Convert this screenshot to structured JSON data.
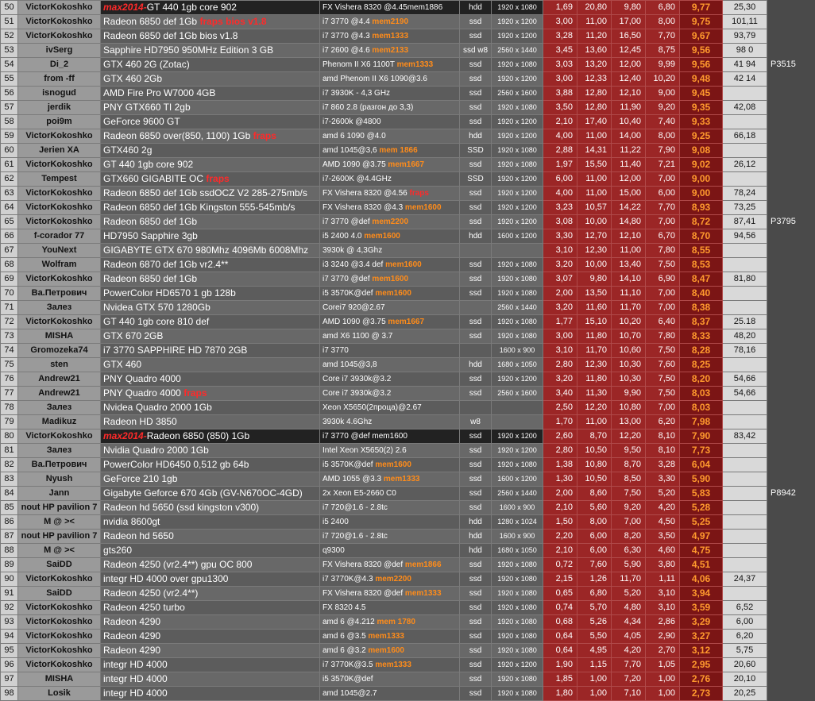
{
  "rows": [
    {
      "n": "50",
      "user": "VictorKokoshko",
      "gpu_prefix": "max2014-",
      "gpu": "GT 440  1gb core 902",
      "gpu_suffix": "",
      "cpu": "FX Vishera  8320 @4.45mem1886",
      "cpu_mem": "",
      "drive": "hdd",
      "res": "1920 x 1080",
      "v1": "1,69",
      "v2": "20,80",
      "v3": "9,80",
      "v4": "6,80",
      "score": "9,77",
      "extra": "25,30",
      "pc": "",
      "hl": true
    },
    {
      "n": "51",
      "user": "VictorKokoshko",
      "gpu_prefix": "",
      "gpu": "Radeon 6850 def  1Gb",
      "gpu_suffix": "fraps      bios v1.8",
      "cpu": "i7 3770 @4.4 ",
      "cpu_mem": "mem2190",
      "drive": "ssd",
      "res": "1920 x 1200",
      "v1": "3,00",
      "v2": "11,00",
      "v3": "17,00",
      "v4": "8,00",
      "score": "9,75",
      "extra": "101,11",
      "pc": ""
    },
    {
      "n": "52",
      "user": "VictorKokoshko",
      "gpu_prefix": "",
      "gpu": "Radeon 6850 def  1Gb                       bios v1.8",
      "gpu_suffix": "",
      "cpu": "i7 3770 @4.3 ",
      "cpu_mem": "mem1333",
      "drive": "ssd",
      "res": "1920 x 1200",
      "v1": "3,28",
      "v2": "11,20",
      "v3": "16,50",
      "v4": "7,70",
      "score": "9,67",
      "extra": "93,79",
      "pc": ""
    },
    {
      "n": "53",
      "user": "ivSerg",
      "gpu_prefix": "",
      "gpu": "Sapphire HD7950 950MHz Edition 3 GB",
      "gpu_suffix": "",
      "cpu": "i7 2600 @4.6 ",
      "cpu_mem": "mem2133",
      "drive": "ssd w8",
      "res": "2560 x 1440",
      "v1": "3,45",
      "v2": "13,60",
      "v3": "12,45",
      "v4": "8,75",
      "score": "9,56",
      "extra": "98  0",
      "pc": ""
    },
    {
      "n": "54",
      "user": "Di_2",
      "gpu_prefix": "",
      "gpu": "GTX 460 2G (Zotac)",
      "gpu_suffix": "",
      "cpu": "Phenom II X6 1100T ",
      "cpu_mem": "mem1333",
      "drive": "ssd",
      "res": "1920 x 1080",
      "v1": "3,03",
      "v2": "13,20",
      "v3": "12,00",
      "v4": "9,99",
      "score": "9,56",
      "extra": "41  94",
      "pc": "P3515"
    },
    {
      "n": "55",
      "user": "from -ff",
      "gpu_prefix": "",
      "gpu": "GTX 460 2Gb",
      "gpu_suffix": "",
      "cpu": "amd Phenom II X6 1090@3.6",
      "cpu_mem": "",
      "drive": "ssd",
      "res": "1920 x 1200",
      "v1": "3,00",
      "v2": "12,33",
      "v3": "12,40",
      "v4": "10,20",
      "score": "9,48",
      "extra": "42  14",
      "pc": ""
    },
    {
      "n": "56",
      "user": "isnogud",
      "gpu_prefix": "",
      "gpu": "AMD Fire Pro W7000 4GB",
      "gpu_suffix": "",
      "cpu": "i7 3930K - 4,3 GHz",
      "cpu_mem": "",
      "drive": "ssd",
      "res": "2560 x 1600",
      "v1": "3,88",
      "v2": "12,80",
      "v3": "12,10",
      "v4": "9,00",
      "score": "9,45",
      "extra": "",
      "pc": ""
    },
    {
      "n": "57",
      "user": "jerdik",
      "gpu_prefix": "",
      "gpu": "PNY GTX660 TI 2gb",
      "gpu_suffix": "",
      "cpu": "i7 860 2.8 (разгон до 3,3)",
      "cpu_mem": "",
      "drive": "ssd",
      "res": "1920 x 1080",
      "v1": "3,50",
      "v2": "12,80",
      "v3": "11,90",
      "v4": "9,20",
      "score": "9,35",
      "extra": "42,08",
      "pc": ""
    },
    {
      "n": "58",
      "user": "poi9m",
      "gpu_prefix": "",
      "gpu": "GeForce 9600 GT",
      "gpu_suffix": "",
      "cpu": "i7-2600k @4800",
      "cpu_mem": "",
      "drive": "ssd",
      "res": "1920 x 1200",
      "v1": "2,10",
      "v2": "17,40",
      "v3": "10,40",
      "v4": "7,40",
      "score": "9,33",
      "extra": "",
      "pc": ""
    },
    {
      "n": "59",
      "user": "VictorKokoshko",
      "gpu_prefix": "",
      "gpu": "Radeon 6850 over(850, 1100) 1Gb",
      "gpu_suffix": "fraps",
      "cpu": "amd 6  1090 @4.0",
      "cpu_mem": "",
      "drive": "hdd",
      "res": "1920 x 1200",
      "v1": "4,00",
      "v2": "11,00",
      "v3": "14,00",
      "v4": "8,00",
      "score": "9,25",
      "extra": "66,18",
      "pc": ""
    },
    {
      "n": "60",
      "user": "Jerien XA",
      "gpu_prefix": "",
      "gpu": "GTX460 2g",
      "gpu_suffix": "",
      "cpu": "amd 1045@3,6 ",
      "cpu_mem": "mem 1866",
      "drive": "SSD",
      "res": "1920 x 1080",
      "v1": "2,88",
      "v2": "14,31",
      "v3": "11,22",
      "v4": "7,90",
      "score": "9,08",
      "extra": "",
      "pc": ""
    },
    {
      "n": "61",
      "user": "VictorKokoshko",
      "gpu_prefix": "",
      "gpu": "GT 440  1gb core 902",
      "gpu_suffix": "",
      "cpu": "AMD 1090 @3.75 ",
      "cpu_mem": "mem1667",
      "drive": "ssd",
      "res": "1920 x 1080",
      "v1": "1,97",
      "v2": "15,50",
      "v3": "11,40",
      "v4": "7,21",
      "score": "9,02",
      "extra": "26,12",
      "pc": ""
    },
    {
      "n": "62",
      "user": "Tempest",
      "gpu_prefix": "",
      "gpu": "GTX660 GIGABITE OC",
      "gpu_suffix": "fraps",
      "cpu": "i7-2600K @4.4GHz",
      "cpu_mem": "",
      "drive": "SSD",
      "res": "1920 x 1200",
      "v1": "6,00",
      "v2": "11,00",
      "v3": "12,00",
      "v4": "7,00",
      "score": "9,00",
      "extra": "",
      "pc": ""
    },
    {
      "n": "63",
      "user": "VictorKokoshko",
      "gpu_prefix": "",
      "gpu": "Radeon 6850 def  1Gb  ssdOCZ V2 285-275mb/s",
      "gpu_suffix": "",
      "cpu": "FX Vishera  8320 @4.56 ",
      "cpu_mem": "fraps",
      "drive": "ssd",
      "res": "1920 x 1200",
      "v1": "4,00",
      "v2": "11,00",
      "v3": "15,00",
      "v4": "6,00",
      "score": "9,00",
      "extra": "78,24",
      "pc": ""
    },
    {
      "n": "64",
      "user": "VictorKokoshko",
      "gpu_prefix": "",
      "gpu": "Radeon 6850 def  1Gb   Kingston 555-545mb/s",
      "gpu_suffix": "",
      "cpu": "FX Vishera  8320 @4.3 ",
      "cpu_mem": "mem1600",
      "drive": "ssd",
      "res": "1920 x 1200",
      "v1": "3,23",
      "v2": "10,57",
      "v3": "14,22",
      "v4": "7,70",
      "score": "8,93",
      "extra": "73,25",
      "pc": ""
    },
    {
      "n": "65",
      "user": "VictorKokoshko",
      "gpu_prefix": "",
      "gpu": "Radeon 6850 def  1Gb",
      "gpu_suffix": "",
      "cpu": "i7 3770 @def ",
      "cpu_mem": "mem2200",
      "drive": "ssd",
      "res": "1920 x 1200",
      "v1": "3,08",
      "v2": "10,00",
      "v3": "14,80",
      "v4": "7,00",
      "score": "8,72",
      "extra": "87,41",
      "pc": "P3795"
    },
    {
      "n": "66",
      "user": "f-corador 77",
      "gpu_prefix": "",
      "gpu": "HD7950 Sapphire 3gb",
      "gpu_suffix": "",
      "cpu": "i5 2400 4.0 ",
      "cpu_mem": "mem1600",
      "drive": "hdd",
      "res": "1600 x 1200",
      "v1": "3,30",
      "v2": "12,70",
      "v3": "12,10",
      "v4": "6,70",
      "score": "8,70",
      "extra": "94,56",
      "pc": ""
    },
    {
      "n": "67",
      "user": "YouNext",
      "gpu_prefix": "",
      "gpu": "GIGABYTE GTX 670 980Mhz 4096Mb 6008Mhz",
      "gpu_suffix": "",
      "cpu": "3930k @ 4,3Ghz",
      "cpu_mem": "",
      "drive": "",
      "res": "",
      "v1": "3,10",
      "v2": "12,30",
      "v3": "11,00",
      "v4": "7,80",
      "score": "8,55",
      "extra": "",
      "pc": ""
    },
    {
      "n": "68",
      "user": "Wolfram",
      "gpu_prefix": "",
      "gpu": "Radeon 6870 def  1Gb  vr2.4**",
      "gpu_suffix": "",
      "cpu": "i3 3240 @3.4 def ",
      "cpu_mem": "mem1600",
      "drive": "ssd",
      "res": "1920 x 1080",
      "v1": "3,20",
      "v2": "10,00",
      "v3": "13,40",
      "v4": "7,50",
      "score": "8,53",
      "extra": "",
      "pc": ""
    },
    {
      "n": "69",
      "user": "VictorKokoshko",
      "gpu_prefix": "",
      "gpu": "Radeon 6850 def  1Gb",
      "gpu_suffix": "",
      "cpu": "i7 3770 @def ",
      "cpu_mem": "mem1600",
      "drive": "ssd",
      "res": "1920 x 1080",
      "v1": "3,07",
      "v2": "9,80",
      "v3": "14,10",
      "v4": "6,90",
      "score": "8,47",
      "extra": "81,80",
      "pc": ""
    },
    {
      "n": "70",
      "user": "Ва.Петрович",
      "gpu_prefix": "",
      "gpu": "PowerColor HD6570  1 gb 128b",
      "gpu_suffix": "",
      "cpu": "i5 3570K@def ",
      "cpu_mem": "mem1600",
      "drive": "ssd",
      "res": "1920 x 1080",
      "v1": "2,00",
      "v2": "13,50",
      "v3": "11,10",
      "v4": "7,00",
      "score": "8,40",
      "extra": "",
      "pc": ""
    },
    {
      "n": "71",
      "user": "Залез",
      "gpu_prefix": "",
      "gpu": "Nvidea GTX 570 1280Gb",
      "gpu_suffix": "",
      "cpu": "Corei7 920@2.67",
      "cpu_mem": "",
      "drive": "",
      "res": "2560 x 1440",
      "v1": "3,20",
      "v2": "11,60",
      "v3": "11,70",
      "v4": "7,00",
      "score": "8,38",
      "extra": "",
      "pc": ""
    },
    {
      "n": "72",
      "user": "VictorKokoshko",
      "gpu_prefix": "",
      "gpu": "GT 440  1gb core 810 def",
      "gpu_suffix": "",
      "cpu": "AMD 1090 @3.75 ",
      "cpu_mem": "mem1667",
      "drive": "ssd",
      "res": "1920 x 1080",
      "v1": "1,77",
      "v2": "15,10",
      "v3": "10,20",
      "v4": "6,40",
      "score": "8,37",
      "extra": "25.18",
      "pc": ""
    },
    {
      "n": "73",
      "user": "MISHA",
      "gpu_prefix": "",
      "gpu": "GTX 670 2GB",
      "gpu_suffix": "",
      "cpu": "amd X6 1100 @ 3.7",
      "cpu_mem": "",
      "drive": "ssd",
      "res": "1920 x 1080",
      "v1": "3,00",
      "v2": "11,80",
      "v3": "10,70",
      "v4": "7,80",
      "score": "8,33",
      "extra": "48,20",
      "pc": ""
    },
    {
      "n": "74",
      "user": "Gromozeka74",
      "gpu_prefix": "",
      "gpu": "i7 3770 SAPPHIRE HD 7870 2GB",
      "gpu_suffix": "",
      "cpu": "i7 3770",
      "cpu_mem": "",
      "drive": "",
      "res": "1600 x 900",
      "v1": "3,10",
      "v2": "11,70",
      "v3": "10,60",
      "v4": "7,50",
      "score": "8,28",
      "extra": "78,16",
      "pc": ""
    },
    {
      "n": "75",
      "user": "sten",
      "gpu_prefix": "",
      "gpu": "GTX 460",
      "gpu_suffix": "",
      "cpu": "amd 1045@3,8",
      "cpu_mem": "",
      "drive": "hdd",
      "res": "1680 x 1050",
      "v1": "2,80",
      "v2": "12,30",
      "v3": "10,30",
      "v4": "7,60",
      "score": "8,25",
      "extra": "",
      "pc": ""
    },
    {
      "n": "76",
      "user": "Andrew21",
      "gpu_prefix": "",
      "gpu": "PNY Quadro 4000",
      "gpu_suffix": "",
      "cpu": "Core i7 3930k@3.2",
      "cpu_mem": "",
      "drive": "ssd",
      "res": "1920 x 1200",
      "v1": "3,20",
      "v2": "11,80",
      "v3": "10,30",
      "v4": "7,50",
      "score": "8,20",
      "extra": "54,66",
      "pc": ""
    },
    {
      "n": "77",
      "user": "Andrew21",
      "gpu_prefix": "",
      "gpu": "PNY Quadro 4000",
      "gpu_suffix": "fraps",
      "cpu": "Core i7 3930k@3.2",
      "cpu_mem": "",
      "drive": "ssd",
      "res": "2560 x 1600",
      "v1": "3,40",
      "v2": "11,30",
      "v3": "9,90",
      "v4": "7,50",
      "score": "8,03",
      "extra": "54,66",
      "pc": ""
    },
    {
      "n": "78",
      "user": "Залез",
      "gpu_prefix": "",
      "gpu": "Nvidea Quadro 2000 1Gb",
      "gpu_suffix": "",
      "cpu": "Xeon X5650(2проца)@2.67",
      "cpu_mem": "",
      "drive": "",
      "res": "",
      "v1": "2,50",
      "v2": "12,20",
      "v3": "10,80",
      "v4": "7,00",
      "score": "8,03",
      "extra": "",
      "pc": ""
    },
    {
      "n": "79",
      "user": "Madikuz",
      "gpu_prefix": "",
      "gpu": "Radeon HD 3850",
      "gpu_suffix": "",
      "cpu": "3930k 4.6Ghz",
      "cpu_mem": "",
      "drive": "w8",
      "res": "",
      "v1": "1,70",
      "v2": "11,00",
      "v3": "13,00",
      "v4": "6,20",
      "score": "7,98",
      "extra": "",
      "pc": ""
    },
    {
      "n": "80",
      "user": "VictorKokoshko",
      "gpu_prefix": "max2014-",
      "gpu": "Radeon 6850 (850)  1Gb",
      "gpu_suffix": "",
      "cpu": "i7 3770 @def mem1600",
      "cpu_mem": "",
      "drive": "ssd",
      "res": "1920 x 1200",
      "v1": "2,60",
      "v2": "8,70",
      "v3": "12,20",
      "v4": "8,10",
      "score": "7,90",
      "extra": "83,42",
      "pc": "",
      "hl": true
    },
    {
      "n": "81",
      "user": "Залез",
      "gpu_prefix": "",
      "gpu": "Nvidia Quadro 2000 1Gb",
      "gpu_suffix": "",
      "cpu": "Intel Xeon X5650(2) 2.6",
      "cpu_mem": "",
      "drive": "ssd",
      "res": "1920 x 1200",
      "v1": "2,80",
      "v2": "10,50",
      "v3": "9,50",
      "v4": "8,10",
      "score": "7,73",
      "extra": "",
      "pc": ""
    },
    {
      "n": "82",
      "user": "Ва.Петрович",
      "gpu_prefix": "",
      "gpu": "PowerColor HD6450 0,512 gb 64b",
      "gpu_suffix": "",
      "cpu": "i5 3570K@def ",
      "cpu_mem": "mem1600",
      "drive": "ssd",
      "res": "1920 x 1080",
      "v1": "1,38",
      "v2": "10,80",
      "v3": "8,70",
      "v4": "3,28",
      "score": "6,04",
      "extra": "",
      "pc": ""
    },
    {
      "n": "83",
      "user": "Nyush",
      "gpu_prefix": "",
      "gpu": "GeForce  210  1gb",
      "gpu_suffix": "",
      "cpu": "AMD 1055 @3.3 ",
      "cpu_mem": "mem1333",
      "drive": "ssd",
      "res": "1600 x 1200",
      "v1": "1,30",
      "v2": "10,50",
      "v3": "8,50",
      "v4": "3,30",
      "score": "5,90",
      "extra": "",
      "pc": ""
    },
    {
      "n": "84",
      "user": "Jann",
      "gpu_prefix": "",
      "gpu": "Gigabyte Geforce 670 4Gb (GV-N670OC-4GD)",
      "gpu_suffix": "",
      "cpu": "2x Xeon E5-2660 C0",
      "cpu_mem": "",
      "drive": "ssd",
      "res": "2560 x 1440",
      "v1": "2,00",
      "v2": "8,60",
      "v3": "7,50",
      "v4": "5,20",
      "score": "5,83",
      "extra": "",
      "pc": "P8942"
    },
    {
      "n": "85",
      "user": "nout HP pavilion 7",
      "gpu_prefix": "",
      "gpu": "Radeon hd 5650 (ssd kingston v300)",
      "gpu_suffix": "",
      "cpu": "i7 720@1.6 - 2.8tc",
      "cpu_mem": "",
      "drive": "ssd",
      "res": "1600 x 900",
      "v1": "2,10",
      "v2": "5,60",
      "v3": "9,20",
      "v4": "4,20",
      "score": "5,28",
      "extra": "",
      "pc": ""
    },
    {
      "n": "86",
      "user": "M @ ><",
      "gpu_prefix": "",
      "gpu": "nvidia 8600gt",
      "gpu_suffix": "",
      "cpu": "i5 2400",
      "cpu_mem": "",
      "drive": "hdd",
      "res": "1280 x 1024",
      "v1": "1,50",
      "v2": "8,00",
      "v3": "7,00",
      "v4": "4,50",
      "score": "5,25",
      "extra": "",
      "pc": ""
    },
    {
      "n": "87",
      "user": "nout HP pavilion 7",
      "gpu_prefix": "",
      "gpu": "Radeon hd 5650",
      "gpu_suffix": "",
      "cpu": "i7 720@1.6 - 2.8tc",
      "cpu_mem": "",
      "drive": "hdd",
      "res": "1600 x 900",
      "v1": "2,20",
      "v2": "6,00",
      "v3": "8,20",
      "v4": "3,50",
      "score": "4,97",
      "extra": "",
      "pc": ""
    },
    {
      "n": "88",
      "user": "M @ ><",
      "gpu_prefix": "",
      "gpu": "gts260",
      "gpu_suffix": "",
      "cpu": "q9300",
      "cpu_mem": "",
      "drive": "hdd",
      "res": "1680 x 1050",
      "v1": "2,10",
      "v2": "6,00",
      "v3": "6,30",
      "v4": "4,60",
      "score": "4,75",
      "extra": "",
      "pc": ""
    },
    {
      "n": "89",
      "user": "SaiDD",
      "gpu_prefix": "",
      "gpu": "Radeon 4250 (vr2.4**) gpu OC 800",
      "gpu_suffix": "",
      "cpu": "FX Vishera  8320 @def ",
      "cpu_mem": "mem1866",
      "drive": "ssd",
      "res": "1920 x 1080",
      "v1": "0,72",
      "v2": "7,60",
      "v3": "5,90",
      "v4": "3,80",
      "score": "4,51",
      "extra": "",
      "pc": ""
    },
    {
      "n": "90",
      "user": "VictorKokoshko",
      "gpu_prefix": "",
      "gpu": "integr HD 4000 over gpu1300",
      "gpu_suffix": "",
      "cpu": "i7 3770K@4.3 ",
      "cpu_mem": "mem2200",
      "drive": "ssd",
      "res": "1920 x 1080",
      "v1": "2,15",
      "v2": "1,26",
      "v3": "11,70",
      "v4": "1,11",
      "score": "4,06",
      "extra": "24,37",
      "pc": ""
    },
    {
      "n": "91",
      "user": "SaiDD",
      "gpu_prefix": "",
      "gpu": "Radeon 4250 (vr2.4**)",
      "gpu_suffix": "",
      "cpu": "FX Vishera  8320 @def ",
      "cpu_mem": "mem1333",
      "drive": "ssd",
      "res": "1920 x 1080",
      "v1": "0,65",
      "v2": "6,80",
      "v3": "5,20",
      "v4": "3,10",
      "score": "3,94",
      "extra": "",
      "pc": ""
    },
    {
      "n": "92",
      "user": "VictorKokoshko",
      "gpu_prefix": "",
      "gpu": "Radeon 4250 turbo",
      "gpu_suffix": "",
      "cpu": "FX 8320 4.5",
      "cpu_mem": "",
      "drive": "ssd",
      "res": "1920 x 1080",
      "v1": "0,74",
      "v2": "5,70",
      "v3": "4,80",
      "v4": "3,10",
      "score": "3,59",
      "extra": "6,52",
      "pc": ""
    },
    {
      "n": "93",
      "user": "VictorKokoshko",
      "gpu_prefix": "",
      "gpu": "Radeon 4290",
      "gpu_suffix": "",
      "cpu": "amd 6 @4.212 ",
      "cpu_mem": "mem 1780",
      "drive": "ssd",
      "res": "1920 x 1080",
      "v1": "0,68",
      "v2": "5,26",
      "v3": "4,34",
      "v4": "2,86",
      "score": "3,29",
      "extra": "6,00",
      "pc": ""
    },
    {
      "n": "94",
      "user": "VictorKokoshko",
      "gpu_prefix": "",
      "gpu": "Radeon 4290",
      "gpu_suffix": "",
      "cpu": "amd 6 @3.5 ",
      "cpu_mem": "mem1333",
      "drive": "ssd",
      "res": "1920 x 1080",
      "v1": "0,64",
      "v2": "5,50",
      "v3": "4,05",
      "v4": "2,90",
      "score": "3,27",
      "extra": "6,20",
      "pc": ""
    },
    {
      "n": "95",
      "user": "VictorKokoshko",
      "gpu_prefix": "",
      "gpu": "Radeon 4290",
      "gpu_suffix": "",
      "cpu": "amd 6 @3.2 ",
      "cpu_mem": "mem1600",
      "drive": "ssd",
      "res": "1920 x 1080",
      "v1": "0,64",
      "v2": "4,95",
      "v3": "4,20",
      "v4": "2,70",
      "score": "3,12",
      "extra": "5,75",
      "pc": ""
    },
    {
      "n": "96",
      "user": "VictorKokoshko",
      "gpu_prefix": "",
      "gpu": "integr HD 4000",
      "gpu_suffix": "",
      "cpu": "i7 3770K@3.5 ",
      "cpu_mem": "mem1333",
      "drive": "ssd",
      "res": "1920 x 1200",
      "v1": "1,90",
      "v2": "1,15",
      "v3": "7,70",
      "v4": "1,05",
      "score": "2,95",
      "extra": "20,60",
      "pc": ""
    },
    {
      "n": "97",
      "user": "MISHA",
      "gpu_prefix": "",
      "gpu": "integr HD 4000",
      "gpu_suffix": "",
      "cpu": "i5 3570K@def",
      "cpu_mem": "",
      "drive": "ssd",
      "res": "1920 x 1080",
      "v1": "1,85",
      "v2": "1,00",
      "v3": "7,20",
      "v4": "1,00",
      "score": "2,76",
      "extra": "20,10",
      "pc": ""
    },
    {
      "n": "98",
      "user": "Losik",
      "gpu_prefix": "",
      "gpu": "integr HD 4000",
      "gpu_suffix": "",
      "cpu": "amd 1045@2.7",
      "cpu_mem": "",
      "drive": "ssd",
      "res": "1920 x 1080",
      "v1": "1,80",
      "v2": "1,00",
      "v3": "7,10",
      "v4": "1,00",
      "score": "2,73",
      "extra": "20,25",
      "pc": ""
    }
  ]
}
